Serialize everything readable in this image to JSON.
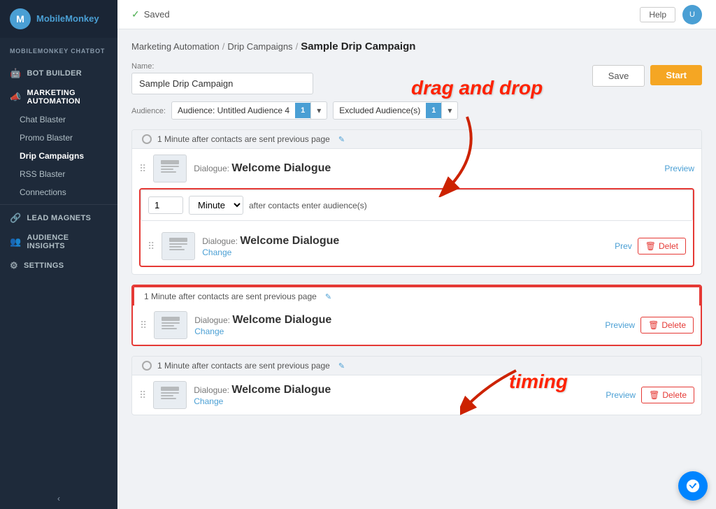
{
  "sidebar": {
    "logo": {
      "text_part1": "Mobile",
      "text_part2": "Monkey"
    },
    "sections": [
      {
        "title": "MobileMonkey Chatbot",
        "items": [
          {
            "id": "bot-builder",
            "label": "Bot Builder",
            "icon": "🤖",
            "active": false
          },
          {
            "id": "marketing-automation",
            "label": "Marketing Automation",
            "icon": "📣",
            "active": true,
            "subitems": [
              {
                "id": "chat-blaster",
                "label": "Chat Blaster",
                "active": false
              },
              {
                "id": "promo-blaster",
                "label": "Promo Blaster",
                "active": false
              },
              {
                "id": "drip-campaigns",
                "label": "Drip Campaigns",
                "active": true
              },
              {
                "id": "rss-blaster",
                "label": "RSS Blaster",
                "active": false
              },
              {
                "id": "connections",
                "label": "Connections",
                "active": false
              }
            ]
          },
          {
            "id": "lead-magnets",
            "label": "Lead Magnets",
            "icon": "🔗",
            "active": false
          },
          {
            "id": "audience-insights",
            "label": "Audience Insights",
            "icon": "👥",
            "active": false
          },
          {
            "id": "settings",
            "label": "Settings",
            "icon": "⚙",
            "active": false
          }
        ]
      }
    ],
    "collapse_label": "‹"
  },
  "topbar": {
    "saved_label": "Saved",
    "help_label": "Help",
    "avatar_initials": "U"
  },
  "breadcrumb": {
    "part1": "Marketing Automation",
    "sep1": "/",
    "part2": "Drip Campaigns",
    "sep2": "/",
    "current": "Sample Drip Campaign"
  },
  "annotations": {
    "drag_and_drop": "drag and drop",
    "timing": "timing"
  },
  "campaign": {
    "name_label": "Name:",
    "name_value": "Sample Drip Campaign",
    "audience_label": "Audience:",
    "audience_select_text": "Audience: Untitled Audience 4",
    "audience_badge": "1",
    "excluded_text": "Excluded Audience(s)",
    "excluded_badge": "1",
    "save_label": "Save",
    "start_label": "Start"
  },
  "steps": [
    {
      "id": "step-1",
      "header": "1 Minute after contacts are sent previous page",
      "highlighted_outer": false,
      "dialogues": [
        {
          "label": "Dialogue:",
          "name": "Welcome Dialogue",
          "preview": "Preview"
        }
      ],
      "is_expanded": true,
      "timing_value": "1",
      "timing_unit": "Minute",
      "timing_text": "after contacts enter audience(s)",
      "inner_dialogue": {
        "label": "Dialogue:",
        "name": "Welcome Dialogue",
        "change": "Change",
        "preview": "Prev",
        "delete": "Delet"
      }
    },
    {
      "id": "step-2",
      "header": "1 Minute after contacts are sent previous page",
      "highlighted_outer": true,
      "dialogues": [
        {
          "label": "Dialogue:",
          "name": "Welcome Dialogue",
          "change": "Change",
          "preview": "Preview",
          "delete": "Delete"
        }
      ],
      "is_expanded": false
    },
    {
      "id": "step-3",
      "header": "1 Minute after contacts are sent previous page",
      "highlighted_outer": false,
      "dialogues": [
        {
          "label": "Dialogue:",
          "name": "Welcome Dialogue",
          "change": "Change",
          "preview": "Preview",
          "delete": "Delete"
        }
      ],
      "is_expanded": false
    }
  ],
  "icons": {
    "drag": "⠿",
    "edit": "✎",
    "trash": "🗑",
    "check": "✓",
    "messenger": "m"
  }
}
